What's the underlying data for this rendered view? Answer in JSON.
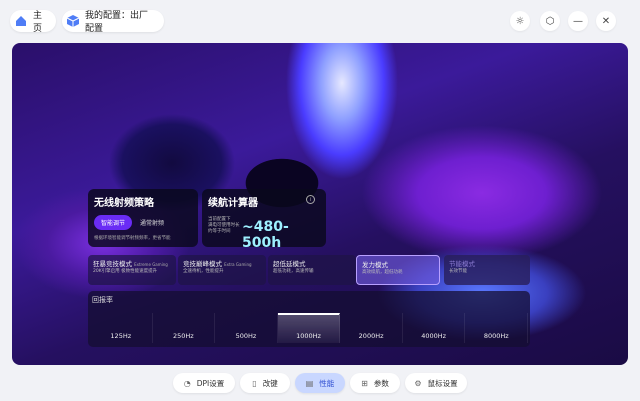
{
  "header": {
    "home_label": "主页",
    "config_label": "我的配置：出厂配置"
  },
  "window_controls": {
    "theme_icon": "sun-icon",
    "settings_icon": "hex-gear-icon",
    "minimize_icon": "minus-icon",
    "close_icon": "close-icon"
  },
  "wireless_card": {
    "title": "无线射频策略",
    "smart_label": "智能调节",
    "manual_label": "通常射频",
    "description": "根据环境智能调节射频频率，更省节能"
  },
  "battery_card": {
    "title": "续航计算器",
    "info_icon": "info-icon",
    "lines": [
      "当前配置下",
      "满电可使用时长",
      "约等于时间"
    ],
    "value": "~480-500h"
  },
  "modes": [
    {
      "label": "狂暴竞技模式",
      "en": "Extreme Gaming",
      "sub": "20K引擎启用 极致性能速度提升"
    },
    {
      "label": "竞技巅峰模式",
      "en": "Extra Gaming",
      "sub": "全速待机，性能提升"
    },
    {
      "label": "超低延模式",
      "en": "",
      "sub": "超低功耗，高速传输"
    },
    {
      "label": "发力模式",
      "en": "",
      "sub": "高效续航，超低功耗"
    },
    {
      "label": "节能模式",
      "en": "",
      "sub": "长效节能"
    }
  ],
  "polling": {
    "label": "回报率",
    "rates": [
      "125Hz",
      "250Hz",
      "500Hz",
      "1000Hz",
      "2000Hz",
      "4000Hz",
      "8000Hz"
    ],
    "selected": "1000Hz"
  },
  "tabs": [
    {
      "label": "DPI设置",
      "icon": "dpi-icon"
    },
    {
      "label": "改键",
      "icon": "mouse-icon"
    },
    {
      "label": "性能",
      "icon": "performance-icon"
    },
    {
      "label": "参数",
      "icon": "grid-icon"
    },
    {
      "label": "鼠标设置",
      "icon": "gear-icon"
    }
  ],
  "colors": {
    "accent": "#6a2cf5",
    "selected_tab_bg": "#c9d7ff"
  }
}
